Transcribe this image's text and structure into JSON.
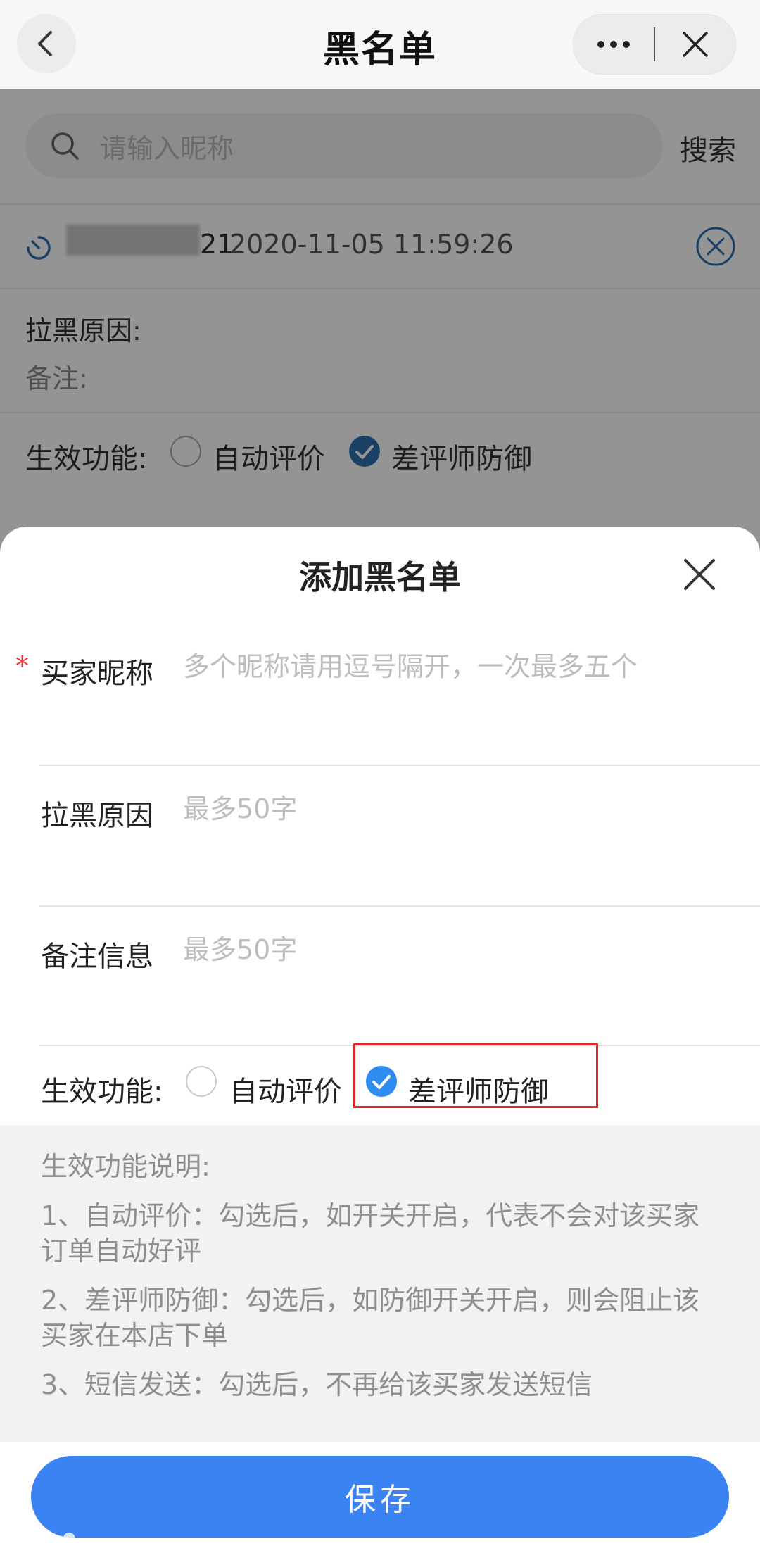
{
  "navbar": {
    "title": "黑名单",
    "back_icon": "chevron-left-icon",
    "more_icon": "more-dots-icon",
    "close_icon": "close-icon"
  },
  "background": {
    "search_placeholder": "请输入昵称",
    "search_button": "搜索",
    "record": {
      "name_visible": "21",
      "time": "2020-11-05 11:59:26"
    },
    "reason_label": "拉黑原因:",
    "remark_label": "备注:",
    "function_label": "生效功能:",
    "option_auto_review": "自动评价",
    "option_defense": "差评师防御"
  },
  "sheet": {
    "title": "添加黑名单",
    "buyer_label": "买家昵称",
    "buyer_placeholder": "多个昵称请用逗号隔开，一次最多五个",
    "reason_label": "拉黑原因",
    "reason_placeholder": "最多50字",
    "remark_label": "备注信息",
    "remark_placeholder": "最多50字",
    "function_label": "生效功能:",
    "option_auto_review": "自动评价",
    "option_auto_review_checked": false,
    "option_defense": "差评师防御",
    "option_defense_checked": true,
    "desc_title": "生效功能说明:",
    "desc_1": "1、自动评价：勾选后，如开关开启，代表不会对该买家订单自动好评",
    "desc_2": "2、差评师防御：勾选后，如防御开关开启，则会阻止该买家在本店下单",
    "desc_3": "3、短信发送：勾选后，不再给该买家发送短信",
    "save_button": "保存"
  },
  "colors": {
    "accent": "#3b82f2",
    "check": "#2f8cf0",
    "highlight": "#e0262b"
  }
}
